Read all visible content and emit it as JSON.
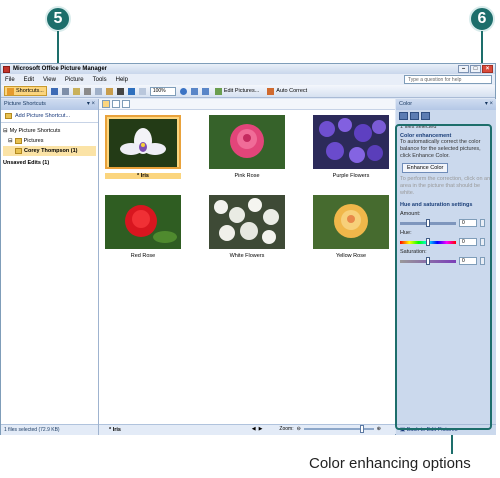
{
  "callouts": {
    "left": "5",
    "right": "6"
  },
  "caption": "Color enhancing options",
  "window": {
    "title": "Microsoft Office Picture Manager",
    "help_placeholder": "Type a question for help"
  },
  "menu": [
    "File",
    "Edit",
    "View",
    "Picture",
    "Tools",
    "Help"
  ],
  "toolbar": {
    "shortcuts_label": "Shortcuts...",
    "zoom_value": "100%",
    "edit_pictures_label": "Edit Pictures...",
    "auto_correct_label": "Auto Correct"
  },
  "left_pane": {
    "header": "Picture Shortcuts",
    "add_shortcut": "Add Picture Shortcut...",
    "tree": [
      {
        "label": "My Picture Shortcuts",
        "level": 0
      },
      {
        "label": "Pictures",
        "level": 1
      },
      {
        "label": "Corey Thompson (1)",
        "level": 2
      },
      {
        "label": "Unsaved Edits (1)",
        "level": 0
      }
    ],
    "status": "1 files selected (72.9 KB)"
  },
  "thumbnails": [
    {
      "caption": "* Iris",
      "selected": true
    },
    {
      "caption": "Pink Rose",
      "selected": false
    },
    {
      "caption": "Purple Flowers",
      "selected": false
    },
    {
      "caption": "Red Rose",
      "selected": false
    },
    {
      "caption": "White Flowers",
      "selected": false
    },
    {
      "caption": "Yellow Rose",
      "selected": false
    }
  ],
  "center_status": {
    "filename": "* Iris",
    "zoom_label": "Zoom:"
  },
  "right_pane": {
    "header": "Color",
    "files_selected": "1 files selected",
    "enhancement_title": "Color enhancement",
    "enhancement_text": "To automatically correct the color balance for the selected pictures, click Enhance Color.",
    "enhance_button": "Enhance Color",
    "dim_text": "To perform the correction, click on an area in the picture that should be white.",
    "hue_sat_title": "Hue and saturation settings",
    "amount_label": "Amount:",
    "amount_value": "0",
    "hue_label": "Hue:",
    "hue_value": "0",
    "saturation_label": "Saturation:",
    "saturation_value": "0",
    "footer_link": "Back to Edit Pictures"
  },
  "colors": {
    "callout": "#1d6e6b",
    "selection": "#fbd57e"
  }
}
